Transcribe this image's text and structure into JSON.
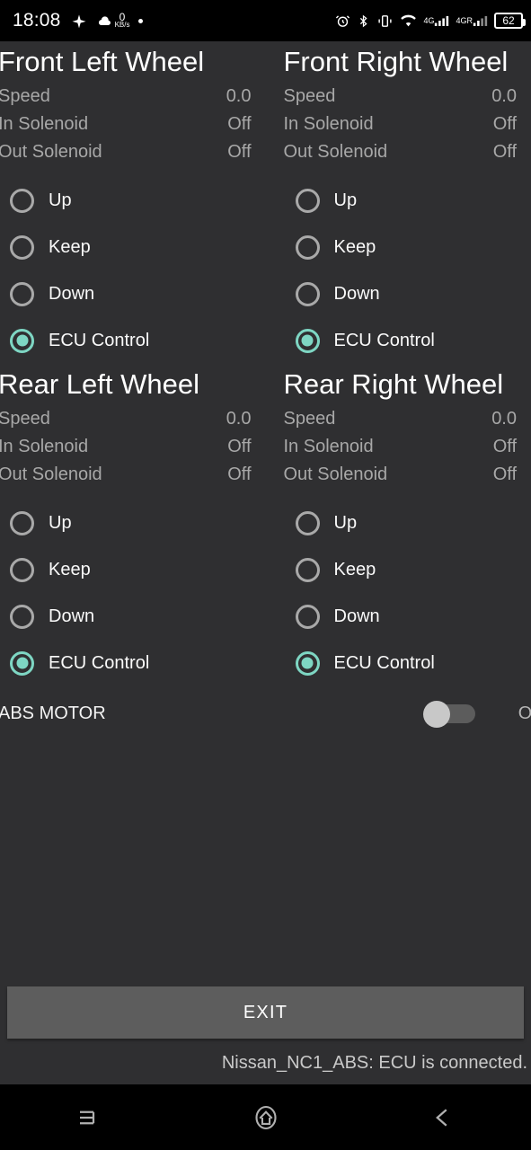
{
  "statusbar": {
    "time": "18:08",
    "netspeed_value": "0",
    "netspeed_unit": "KB/s",
    "battery_level": "62",
    "signal_label_1": "4G",
    "signal_label_2": "4GR",
    "icons": [
      "rocket-icon",
      "cloud-download-icon",
      "dot-icon",
      "alarm-icon",
      "bluetooth-icon",
      "vibrate-icon",
      "wifi-icon",
      "signal-icon",
      "battery-icon"
    ]
  },
  "panels": [
    {
      "title": "Front Left Wheel",
      "stats": [
        {
          "label": "Speed",
          "value": "0.0"
        },
        {
          "label": "In Solenoid",
          "value": "Off"
        },
        {
          "label": "Out Solenoid",
          "value": "Off"
        }
      ],
      "options": [
        {
          "label": "Up",
          "selected": false
        },
        {
          "label": "Keep",
          "selected": false
        },
        {
          "label": "Down",
          "selected": false
        },
        {
          "label": "ECU Control",
          "selected": true
        }
      ]
    },
    {
      "title": "Front Right Wheel",
      "stats": [
        {
          "label": "Speed",
          "value": "0.0"
        },
        {
          "label": "In Solenoid",
          "value": "Off"
        },
        {
          "label": "Out Solenoid",
          "value": "Off"
        }
      ],
      "options": [
        {
          "label": "Up",
          "selected": false
        },
        {
          "label": "Keep",
          "selected": false
        },
        {
          "label": "Down",
          "selected": false
        },
        {
          "label": "ECU Control",
          "selected": true
        }
      ]
    },
    {
      "title": "Rear Left Wheel",
      "stats": [
        {
          "label": "Speed",
          "value": "0.0"
        },
        {
          "label": "In Solenoid",
          "value": "Off"
        },
        {
          "label": "Out Solenoid",
          "value": "Off"
        }
      ],
      "options": [
        {
          "label": "Up",
          "selected": false
        },
        {
          "label": "Keep",
          "selected": false
        },
        {
          "label": "Down",
          "selected": false
        },
        {
          "label": "ECU Control",
          "selected": true
        }
      ]
    },
    {
      "title": "Rear Right Wheel",
      "stats": [
        {
          "label": "Speed",
          "value": "0.0"
        },
        {
          "label": "In Solenoid",
          "value": "Off"
        },
        {
          "label": "Out Solenoid",
          "value": "Off"
        }
      ],
      "options": [
        {
          "label": "Up",
          "selected": false
        },
        {
          "label": "Keep",
          "selected": false
        },
        {
          "label": "Down",
          "selected": false
        },
        {
          "label": "ECU Control",
          "selected": true
        }
      ]
    }
  ],
  "abs_motor": {
    "label": "ABS MOTOR",
    "state": "Off",
    "toggle_on": false
  },
  "footer": {
    "exit_label": "EXIT",
    "status_text": "Nissan_NC1_ABS: ECU is connected."
  },
  "navbar": {
    "recent_label": "recent-apps-icon",
    "home_label": "home-icon",
    "back_label": "back-icon"
  },
  "colors": {
    "background": "#2f2f31",
    "accent_teal": "#7ed6c3",
    "label_gray": "#a8a8a8",
    "button_gray": "#5d5d5d"
  }
}
